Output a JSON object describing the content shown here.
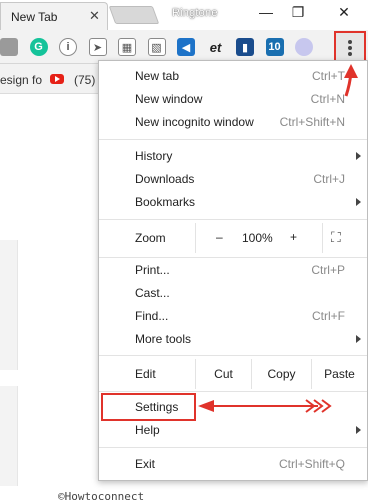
{
  "browser": {
    "tab_title": "New Tab",
    "tab_close": "✕",
    "window_title": "Ringtone",
    "window_buttons": {
      "minimize": "—",
      "maximize": "❐",
      "close": "✕"
    }
  },
  "toolbar": {
    "extensions": [
      {
        "icon": "puzzle-icon",
        "color": "#9a9a9a",
        "glyph": ""
      },
      {
        "icon": "grammarly-icon",
        "color": "#15c39a",
        "glyph": "G"
      },
      {
        "icon": "info-icon",
        "color": "#ffffff",
        "glyph": "i"
      },
      {
        "icon": "cursor-icon",
        "color": "#ffffff",
        "glyph": "➤"
      },
      {
        "icon": "grid-icon",
        "color": "#ffffff",
        "glyph": "▦"
      },
      {
        "icon": "photo-icon",
        "color": "#ffffff",
        "glyph": "▧"
      },
      {
        "icon": "speaker-icon",
        "color": "#1e73c8",
        "glyph": "◀"
      },
      {
        "icon": "et-icon",
        "color": "#ffffff",
        "glyph": "et"
      },
      {
        "icon": "chat-icon",
        "color": "#1a4c8c",
        "glyph": "▮"
      },
      {
        "icon": "badge-10-icon",
        "color": "#1a6fb0",
        "glyph": "10"
      },
      {
        "icon": "circle-icon",
        "color": "#c7c7ee",
        "glyph": ""
      }
    ],
    "menu_button_icon": "kebab-menu-icon"
  },
  "bookmarks": {
    "first_item": "esign fo",
    "youtube_count": "(75)"
  },
  "menu": {
    "new_tab": {
      "label": "New tab",
      "shortcut": "Ctrl+T"
    },
    "new_window": {
      "label": "New window",
      "shortcut": "Ctrl+N"
    },
    "new_incognito": {
      "label": "New incognito window",
      "shortcut": "Ctrl+Shift+N"
    },
    "history": {
      "label": "History"
    },
    "downloads": {
      "label": "Downloads",
      "shortcut": "Ctrl+J"
    },
    "bookmarks": {
      "label": "Bookmarks"
    },
    "zoom": {
      "label": "Zoom",
      "minus": "–",
      "value": "100%",
      "plus": "+",
      "fullscreen": "⛶"
    },
    "print": {
      "label": "Print...",
      "shortcut": "Ctrl+P"
    },
    "cast": {
      "label": "Cast..."
    },
    "find": {
      "label": "Find...",
      "shortcut": "Ctrl+F"
    },
    "more_tools": {
      "label": "More tools"
    },
    "edit": {
      "label": "Edit",
      "cut": "Cut",
      "copy": "Copy",
      "paste": "Paste"
    },
    "settings": {
      "label": "Settings"
    },
    "help": {
      "label": "Help"
    },
    "exit": {
      "label": "Exit",
      "shortcut": "Ctrl+Shift+Q"
    }
  },
  "annotation": {
    "arrow_color": "#e0332b"
  },
  "watermark": "©Howtoconnect"
}
